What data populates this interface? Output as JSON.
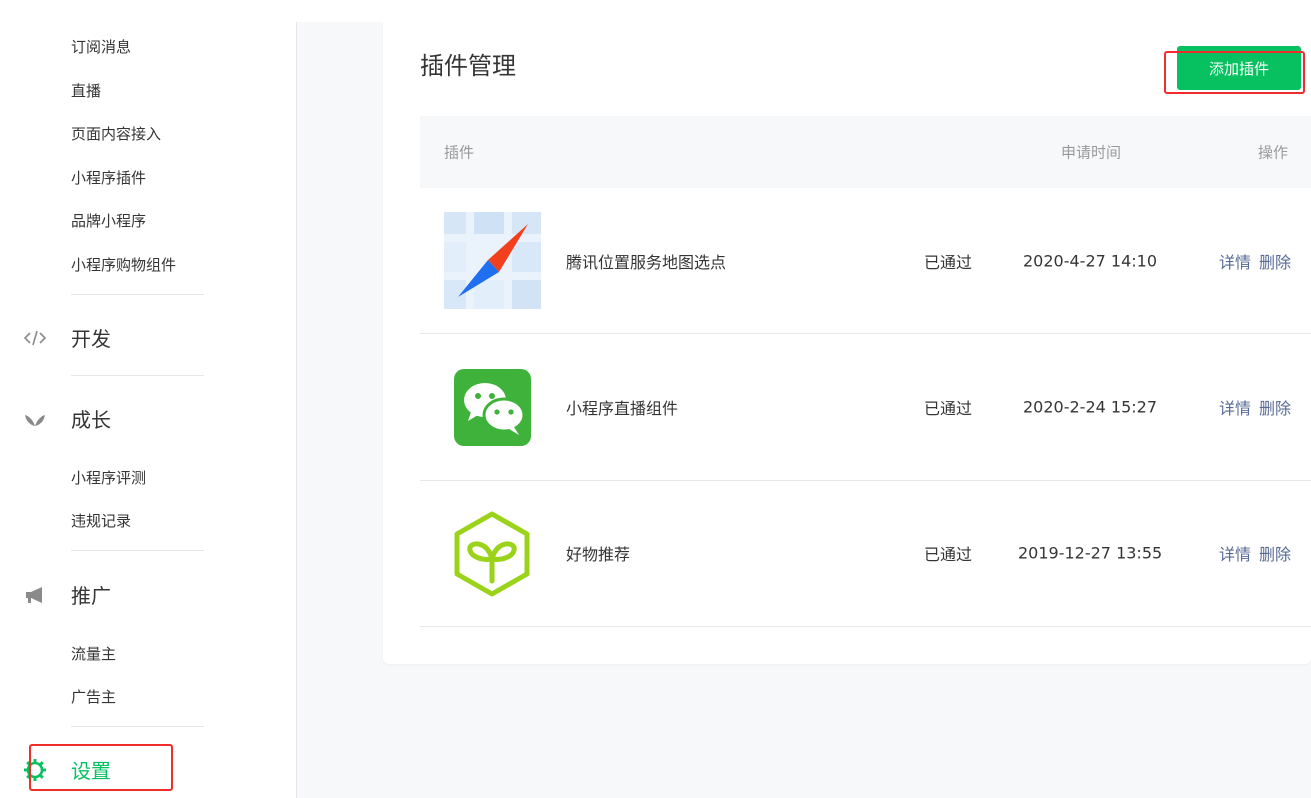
{
  "sidebar": {
    "top_items": [
      "订阅消息",
      "直播",
      "页面内容接入",
      "小程序插件",
      "品牌小程序",
      "小程序购物组件"
    ],
    "dev_label": "开发",
    "growth_label": "成长",
    "growth_items": [
      "小程序评测",
      "违规记录"
    ],
    "promo_label": "推广",
    "promo_items": [
      "流量主",
      "广告主"
    ],
    "settings_label": "设置"
  },
  "main": {
    "title": "插件管理",
    "add_button": "添加插件",
    "columns": {
      "plugin": "插件",
      "apply_time": "申请时间",
      "action": "操作"
    },
    "rows": [
      {
        "name": "腾讯位置服务地图选点",
        "status": "已通过",
        "time": "2020-4-27 14:10",
        "detail": "详情",
        "delete": "删除",
        "icon": "map-compass-icon"
      },
      {
        "name": "小程序直播组件",
        "status": "已通过",
        "time": "2020-2-24 15:27",
        "detail": "详情",
        "delete": "删除",
        "icon": "wechat-icon"
      },
      {
        "name": "好物推荐",
        "status": "已通过",
        "time": "2019-12-27 13:55",
        "detail": "详情",
        "delete": "删除",
        "icon": "sprout-cube-icon"
      }
    ]
  },
  "colors": {
    "accent": "#07c160",
    "link": "#576b95",
    "highlight": "#f12c2c"
  }
}
